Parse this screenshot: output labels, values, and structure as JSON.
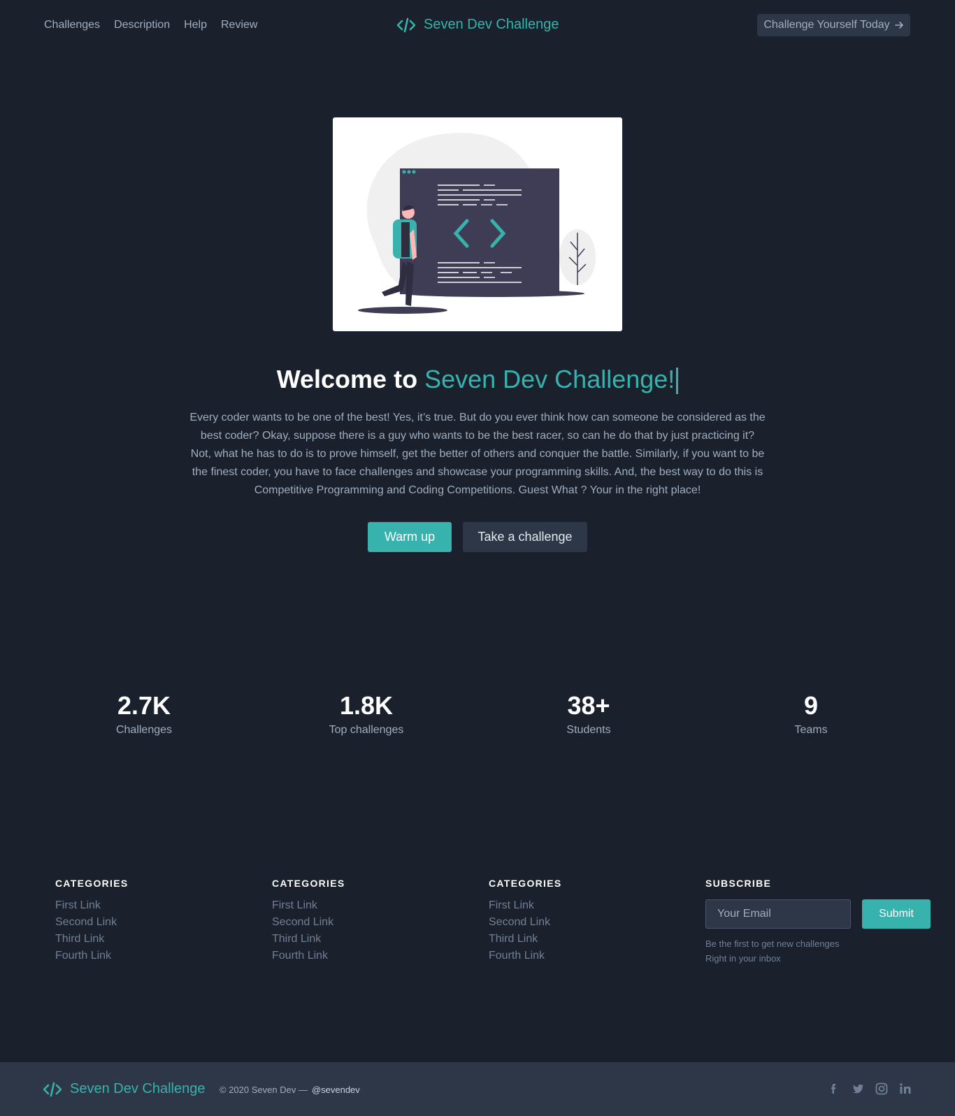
{
  "nav": {
    "items": [
      {
        "label": "Challenges"
      },
      {
        "label": "Description"
      },
      {
        "label": "Help"
      },
      {
        "label": "Review"
      }
    ],
    "brand": "Seven Dev Challenge",
    "cta_label": "Challenge Yourself Today",
    "cta_icon": "arrow-right-icon"
  },
  "hero": {
    "title_prefix": "Welcome to",
    "title_accent": "Seven Dev Challenge!",
    "paragraph": "Every coder wants to be one of the best! Yes, it’s true. But do you ever think how can someone be considered as the best coder? Okay, suppose there is a guy who wants to be the best racer, so can he do that by just practicing it? Not, what he has to do is to prove himself, get the better of others and conquer the battle. Similarly, if you want to be the finest coder, you have to face challenges and showcase your programming skills. And, the best way to do this is Competitive Programming and Coding Competitions. Guest What ? Your in the right place!",
    "primary_button": "Warm up",
    "secondary_button": "Take a challenge"
  },
  "stats": [
    {
      "value": "2.7K",
      "label": "Challenges"
    },
    {
      "value": "1.8K",
      "label": "Top challenges"
    },
    {
      "value": "38+",
      "label": "Students"
    },
    {
      "value": "9",
      "label": "Teams"
    }
  ],
  "footer": {
    "columns": [
      {
        "title": "CATEGORIES",
        "links": [
          "First Link",
          "Second Link",
          "Third Link",
          "Fourth Link"
        ]
      },
      {
        "title": "CATEGORIES",
        "links": [
          "First Link",
          "Second Link",
          "Third Link",
          "Fourth Link"
        ]
      },
      {
        "title": "CATEGORIES",
        "links": [
          "First Link",
          "Second Link",
          "Third Link",
          "Fourth Link"
        ]
      }
    ],
    "subscribe": {
      "title": "SUBSCRIBE",
      "placeholder": "Your Email",
      "button": "Submit",
      "note_line1": "Be the first to get new challenges",
      "note_line2": "Right in your inbox"
    }
  },
  "bottom": {
    "brand": "Seven Dev Challenge",
    "copyright": "© 2020 Seven Dev —",
    "handle": "@sevendev",
    "socials": [
      "facebook-icon",
      "twitter-icon",
      "instagram-icon",
      "linkedin-icon"
    ]
  },
  "colors": {
    "background": "#1a202c",
    "accent": "#38b2ac",
    "surface": "#2d3748"
  }
}
